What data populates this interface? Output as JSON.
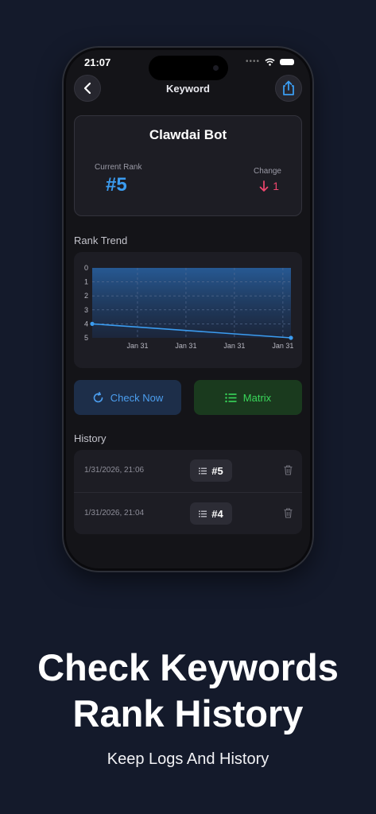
{
  "status_bar": {
    "time": "21:07",
    "signal": "••••"
  },
  "nav": {
    "title": "Keyword",
    "back_icon": "chevron-left-icon",
    "share_icon": "share-icon"
  },
  "summary": {
    "title": "Clawdai Bot",
    "current_rank_label": "Current Rank",
    "current_rank_value": "#5",
    "change_label": "Change",
    "change_value": "1",
    "change_direction": "down",
    "change_color": "#f0466e",
    "rank_color": "#3b9cf0"
  },
  "rank_trend": {
    "title": "Rank Trend"
  },
  "chart_data": {
    "type": "line",
    "y_ticks": [
      "0",
      "1",
      "2",
      "3",
      "4",
      "5"
    ],
    "x_tick_labels": [
      "Jan 31",
      "Jan 31",
      "Jan 31",
      "Jan 31"
    ],
    "ylim": [
      0,
      5
    ],
    "y_inverted": true,
    "grid": true,
    "series": [
      {
        "points": [
          {
            "x": 0,
            "y": 4
          },
          {
            "x": 1,
            "y": 5
          }
        ],
        "color": "#3b9cf0"
      }
    ]
  },
  "actions": {
    "check_now": "Check Now",
    "matrix": "Matrix",
    "check_color": "#4c9ff0",
    "matrix_color": "#39d75a"
  },
  "history": {
    "title": "History",
    "rows": [
      {
        "date": "1/31/2026, 21:06",
        "rank": "#5"
      },
      {
        "date": "1/31/2026, 21:04",
        "rank": "#4"
      }
    ]
  },
  "promo": {
    "headline_line1": "Check Keywords",
    "headline_line2": "Rank History",
    "subheadline": "Keep Logs And History"
  }
}
